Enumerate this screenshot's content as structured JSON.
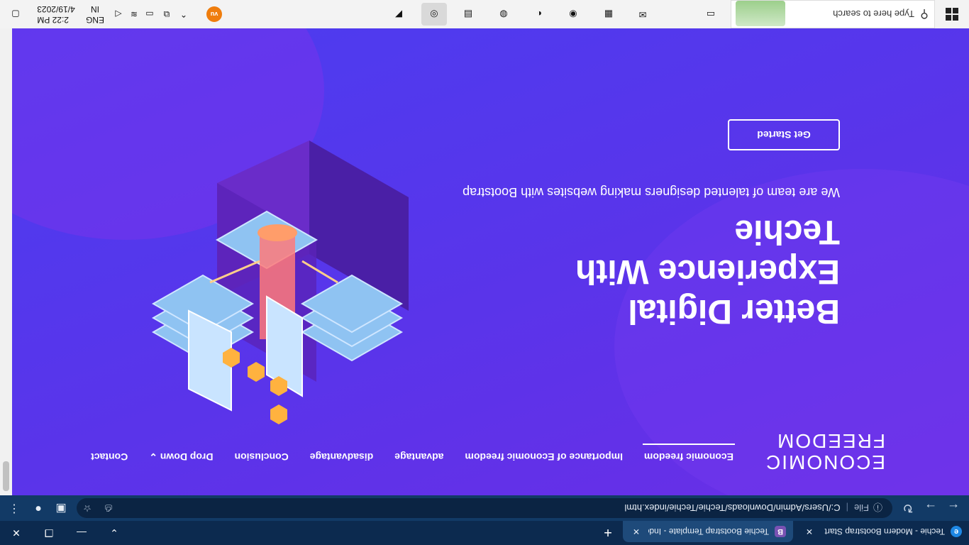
{
  "browser": {
    "tabs": [
      {
        "title": "Techie - Modern Bootstrap Start",
        "favicon": "edge-icon"
      },
      {
        "title": "Techie Bootstrap Template - Inde",
        "favicon": "bootstrap-icon"
      }
    ],
    "address": {
      "scheme_label": "File",
      "url": "C:/Users/Admin/Downloads/Techie/Techie/index.html"
    }
  },
  "page": {
    "logo": {
      "line1": "ECONOMIC",
      "line2": "FREEDOM"
    },
    "nav": [
      {
        "label": "Economic freedom",
        "active": true
      },
      {
        "label": "Importance of Economic freedom"
      },
      {
        "label": "advantage"
      },
      {
        "label": "disadvantage"
      },
      {
        "label": "Conclusion"
      },
      {
        "label": "Drop Down",
        "dropdown_glyph": "⌄"
      },
      {
        "label": "Contact"
      }
    ],
    "hero": {
      "title": "Better Digital Experience With Techie",
      "subtitle": "We are team of talented designers making websites with Bootstrap",
      "cta": "Get Started"
    }
  },
  "taskbar": {
    "search_placeholder": "Type here to search",
    "tray": {
      "lang1": "ENG",
      "lang2": "IN",
      "time": "2:22 PM",
      "date": "4/19/2023",
      "avatar_text": "vu"
    }
  },
  "colors": {
    "hero_start": "#6a2ee6",
    "hero_end": "#4b3df0",
    "tab_bg": "#0c2a4f",
    "taskbar": "#f3f3f3"
  }
}
